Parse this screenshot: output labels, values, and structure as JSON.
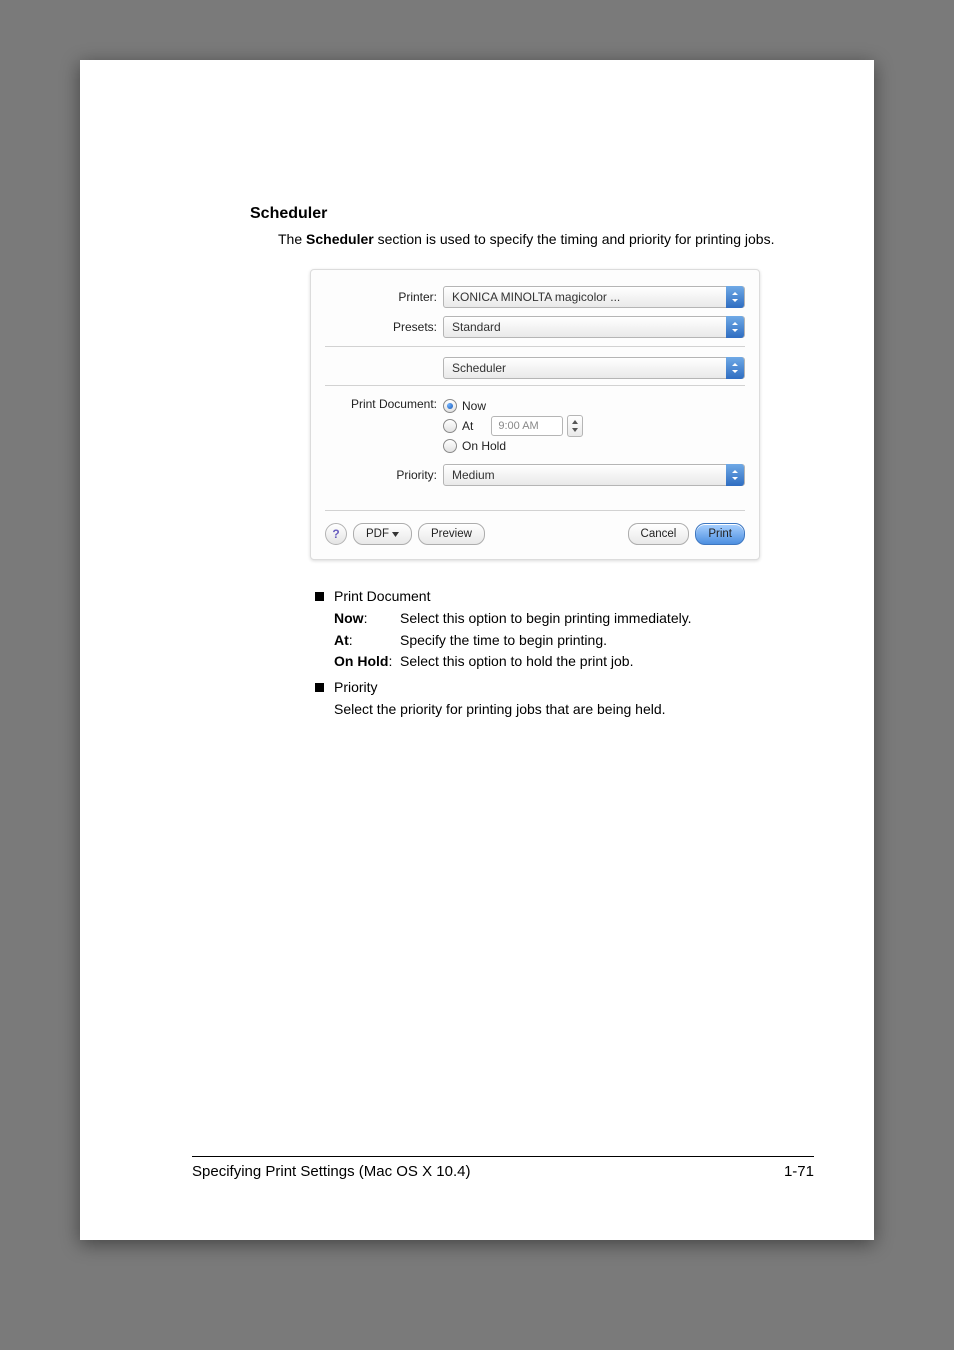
{
  "heading": "Scheduler",
  "intro_prefix": "The ",
  "intro_bold": "Scheduler",
  "intro_rest": " section is used to specify the timing and priority for printing jobs.",
  "dialog": {
    "printer_label": "Printer:",
    "printer_value": "KONICA MINOLTA magicolor ...",
    "presets_label": "Presets:",
    "presets_value": "Standard",
    "section_value": "Scheduler",
    "print_doc_label": "Print Document:",
    "opt_now": "Now",
    "opt_at": "At",
    "opt_on_hold": "On Hold",
    "time_value": "9:00 AM",
    "priority_label": "Priority:",
    "priority_value": "Medium",
    "help": "?",
    "pdf": "PDF",
    "preview": "Preview",
    "cancel": "Cancel",
    "print": "Print"
  },
  "body": {
    "bullet_print_doc": "Print Document",
    "now_term": "Now",
    "colon": ":",
    "now_desc": "Select this option to begin printing immediately.",
    "at_term": "At",
    "at_desc": "Specify the time to begin printing.",
    "on_hold_term": "On Hold",
    "on_hold_desc": "Select this option to hold the print job.",
    "bullet_priority": "Priority",
    "priority_desc": "Select the priority for printing jobs that are being held."
  },
  "footer": {
    "left": "Specifying Print Settings (Mac OS X 10.4)",
    "right": "1-71"
  }
}
